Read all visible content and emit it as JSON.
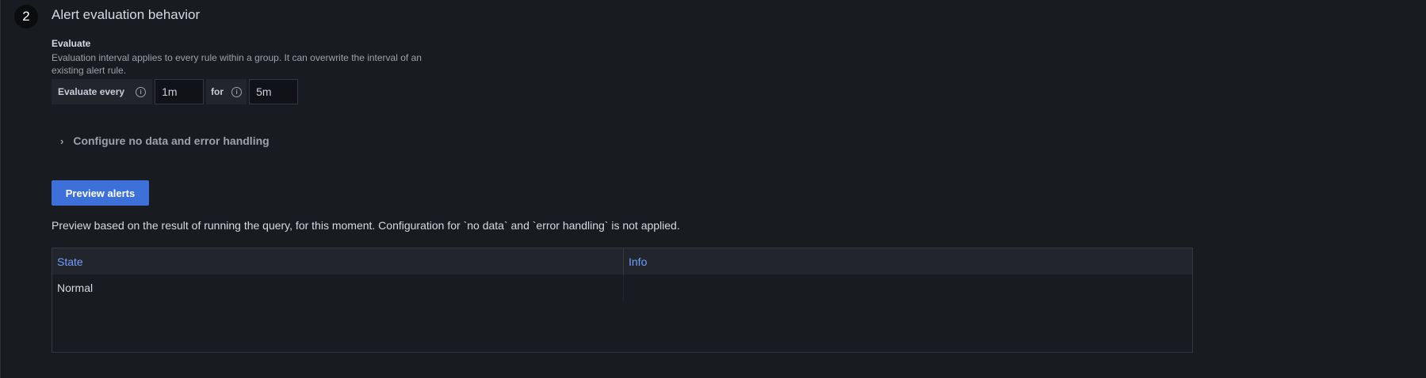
{
  "section": {
    "step_number": "2",
    "title": "Alert evaluation behavior"
  },
  "evaluate": {
    "label": "Evaluate",
    "description": "Evaluation interval applies to every rule within a group. It can overwrite the interval of an existing alert rule.",
    "every_label": "Evaluate every",
    "every_value": "1m",
    "for_label": "for",
    "for_value": "5m"
  },
  "no_data_toggle": {
    "label": "Configure no data and error handling"
  },
  "preview": {
    "button_label": "Preview alerts",
    "note": "Preview based on the result of running the query, for this moment. Configuration for `no data` and `error handling` is not applied."
  },
  "table": {
    "headers": [
      "State",
      "Info"
    ],
    "rows": [
      [
        "Normal",
        ""
      ]
    ]
  },
  "colors": {
    "background": "#181b1f",
    "primary_button": "#3d71d9",
    "header_link": "#6e9fff"
  },
  "icons": {
    "info": "info-circle-icon",
    "chevron": "chevron-right-icon"
  }
}
